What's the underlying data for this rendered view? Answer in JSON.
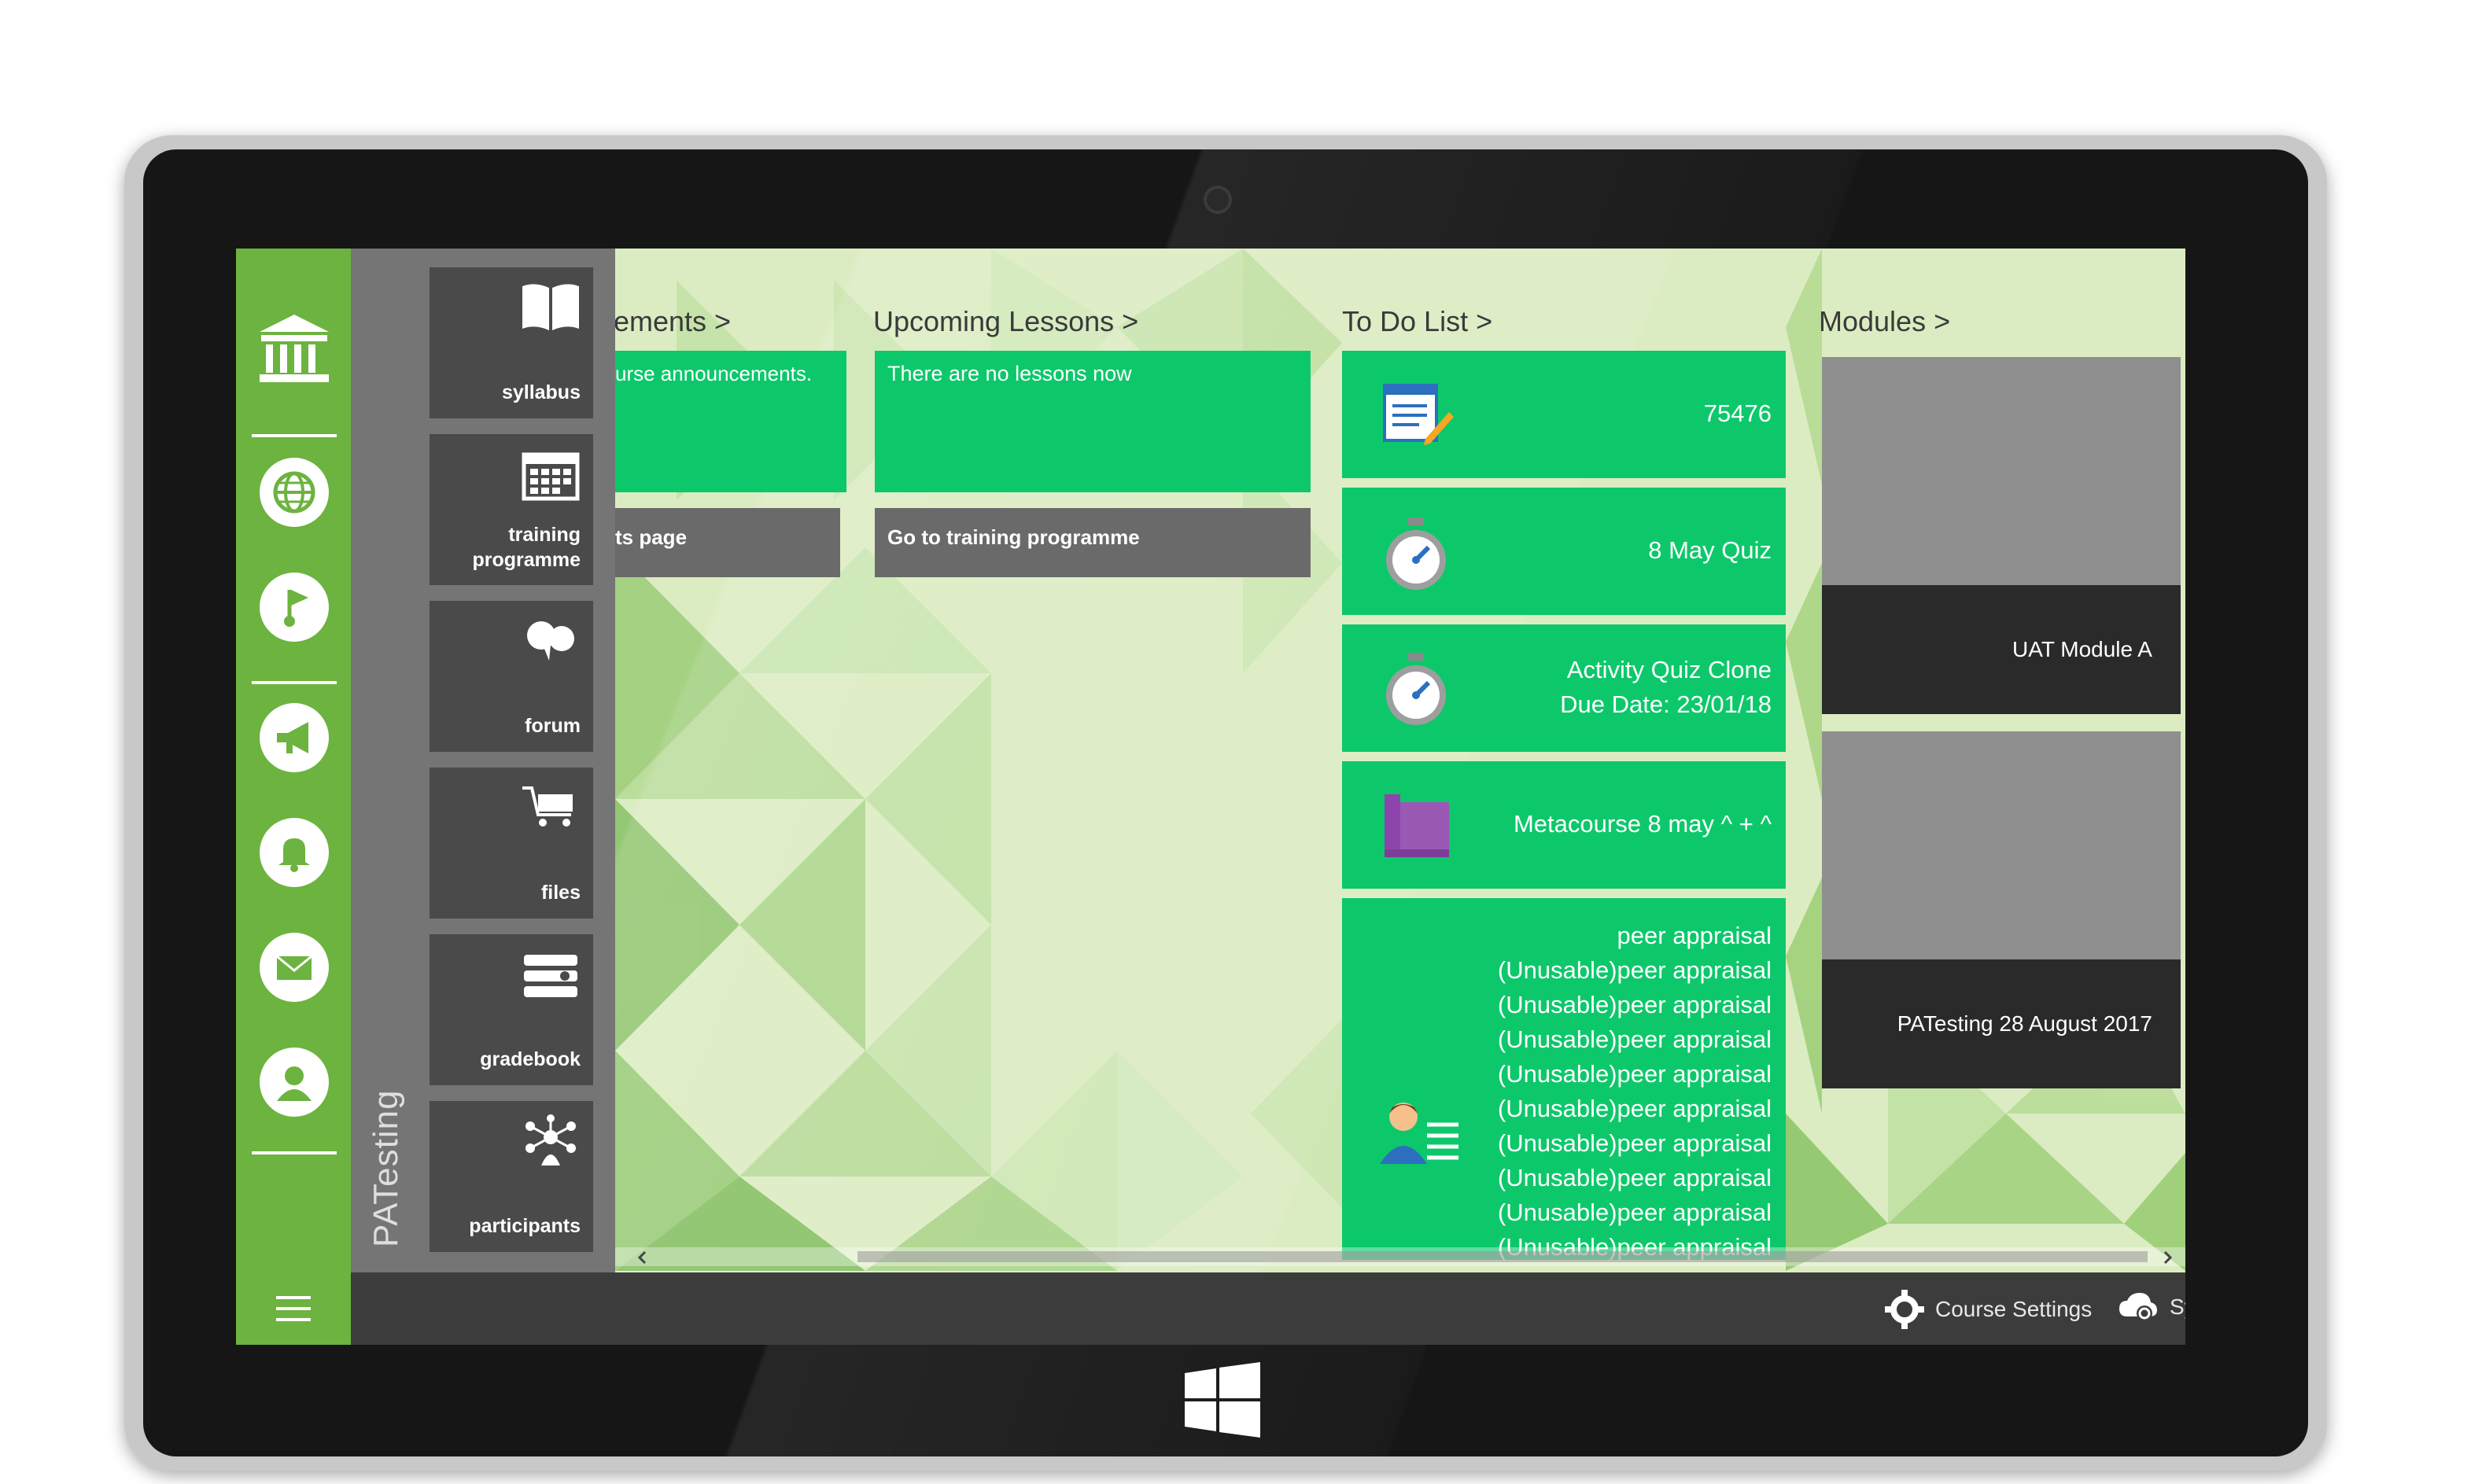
{
  "course": {
    "name": "PATesting"
  },
  "tiles": [
    {
      "label": "syllabus",
      "icon": "book-icon"
    },
    {
      "label": "training programme",
      "icon": "calendar-icon"
    },
    {
      "label": "forum",
      "icon": "forum-icon"
    },
    {
      "label": "files",
      "icon": "files-icon"
    },
    {
      "label": "gradebook",
      "icon": "gradebook-icon"
    },
    {
      "label": "participants",
      "icon": "participants-icon"
    }
  ],
  "sections": {
    "announcements": {
      "heading": "ements >",
      "text": "urse announcements.",
      "link": "ts page"
    },
    "lessons": {
      "heading": "Upcoming Lessons >",
      "text": "There are no lessons now",
      "link": "Go to training programme"
    },
    "todo": {
      "heading": "To Do List >",
      "items": [
        {
          "title": "75476",
          "icon": "notepad-icon"
        },
        {
          "title": "8 May Quiz",
          "icon": "stopwatch-icon"
        },
        {
          "title": "Activity Quiz Clone",
          "due": "Due Date:  23/01/18",
          "icon": "stopwatch-icon"
        },
        {
          "title": "Metacourse 8 may ^ + ^",
          "icon": "metacourse-icon"
        },
        {
          "lines": [
            "peer appraisal",
            "(Unusable)peer appraisal",
            "(Unusable)peer appraisal",
            "(Unusable)peer appraisal",
            "(Unusable)peer appraisal",
            "(Unusable)peer appraisal",
            "(Unusable)peer appraisal",
            "(Unusable)peer appraisal",
            "(Unusable)peer appraisal",
            "(Unusable)peer appraisal"
          ],
          "icon": "appraisal-icon"
        }
      ]
    },
    "modules": {
      "heading": "Modules >",
      "items": [
        "UAT Module A",
        "PATesting 28 August 2017"
      ]
    }
  },
  "bottom_bar": {
    "course_settings": "Course Settings",
    "sync": "Sync This Course"
  },
  "colors": {
    "brand_green": "#6cb33f",
    "tile_green": "#0dc86b",
    "tile_dark": "#4a4a4a"
  }
}
